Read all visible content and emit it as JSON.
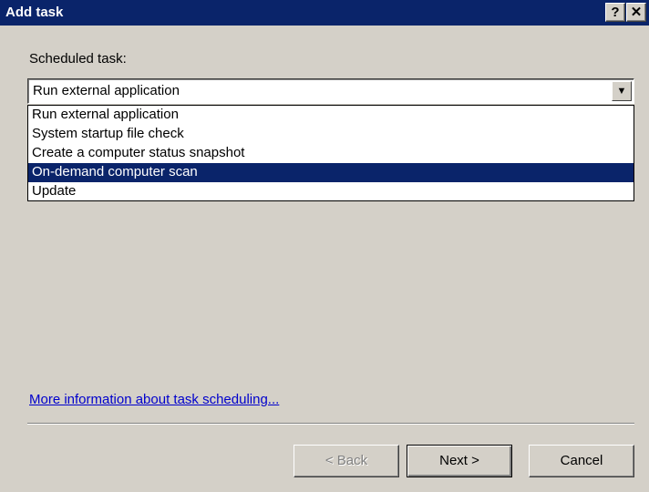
{
  "window": {
    "title": "Add task",
    "help_button": "?",
    "close_button": "✕"
  },
  "form": {
    "scheduled_task_label": "Scheduled task:",
    "selected_value": "Run external application",
    "dropdown_arrow": "▼",
    "options": [
      "Run external application",
      "System startup file check",
      "Create a computer status snapshot",
      "On-demand computer scan",
      "Update"
    ],
    "highlighted_index": 3
  },
  "link": {
    "text": "More information about task scheduling..."
  },
  "buttons": {
    "back": "< Back",
    "next": "Next >",
    "cancel": "Cancel"
  },
  "colors": {
    "titlebar": "#0a246a",
    "dialog_bg": "#d4d0c8",
    "selection": "#0a246a",
    "link": "#0000cc"
  }
}
